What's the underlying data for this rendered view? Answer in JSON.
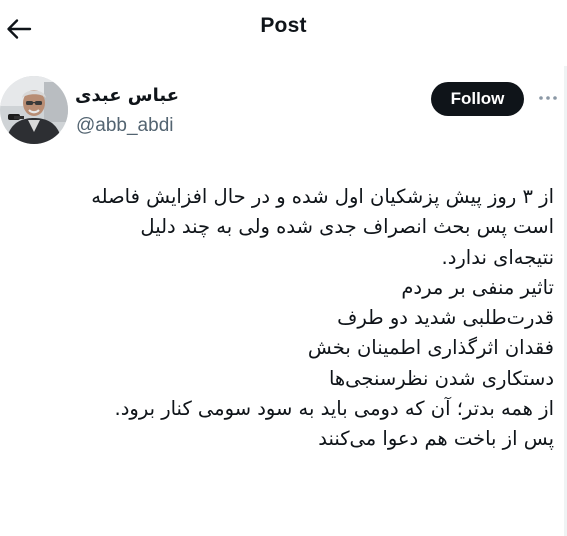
{
  "header": {
    "title": "Post",
    "back_icon": "arrow-left-icon"
  },
  "author": {
    "display_name": "عباس عبدی",
    "handle": "@abb_abdi",
    "follow_label": "Follow",
    "more_icon": "more-horizontal-icon"
  },
  "tweet": {
    "lines": [
      "از ۳ روز پیش پزشکیان اول شده و در حال افزایش فاصله",
      "است پس بحث انصراف جدی شده ولی به چند دلیل",
      "نتیجه‌ای ندارد.",
      "تاثیر منفی بر مردم",
      "قدرت‌طلبی شدید دو طرف",
      "فقدان اثرگذاری اطمینان بخش",
      "دستکاری شدن نظرسنجی‌ها",
      "از همه بدتر؛ آن که دومی باید به سود سومی کنار برود.",
      "پس از باخت هم دعوا می‌کنند"
    ]
  },
  "colors": {
    "text": "#0f1419",
    "secondary": "#536471",
    "follow_bg": "#0f1419",
    "follow_text": "#ffffff"
  }
}
